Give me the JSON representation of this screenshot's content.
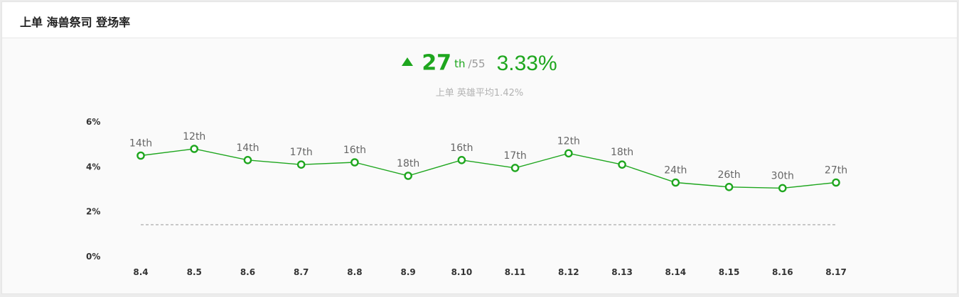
{
  "header": {
    "title": "上单 海兽祭司 登场率"
  },
  "summary": {
    "rank": "27",
    "rank_suffix": "th",
    "rank_total": "/55",
    "rate": "3.33%",
    "average_label": "上单 英雄平均1.42%"
  },
  "colors": {
    "accent": "#1ea61e",
    "avg_line": "#aaaaaa"
  },
  "chart_data": {
    "type": "line",
    "title": "",
    "xlabel": "",
    "ylabel": "",
    "categories": [
      "8.4",
      "8.5",
      "8.6",
      "8.7",
      "8.8",
      "8.9",
      "8.10",
      "8.11",
      "8.12",
      "8.13",
      "8.14",
      "8.15",
      "8.16",
      "8.17"
    ],
    "values": [
      4.5,
      4.8,
      4.3,
      4.1,
      4.2,
      3.6,
      4.3,
      3.95,
      4.6,
      4.1,
      3.3,
      3.1,
      3.05,
      3.3
    ],
    "point_labels": [
      "14th",
      "12th",
      "14th",
      "17th",
      "16th",
      "18th",
      "16th",
      "17th",
      "12th",
      "18th",
      "24th",
      "26th",
      "30th",
      "27th"
    ],
    "average": 1.42,
    "y_ticks": [
      "0%",
      "2%",
      "4%",
      "6%"
    ],
    "ylim": [
      0,
      6
    ],
    "grid": false,
    "legend": "none"
  }
}
